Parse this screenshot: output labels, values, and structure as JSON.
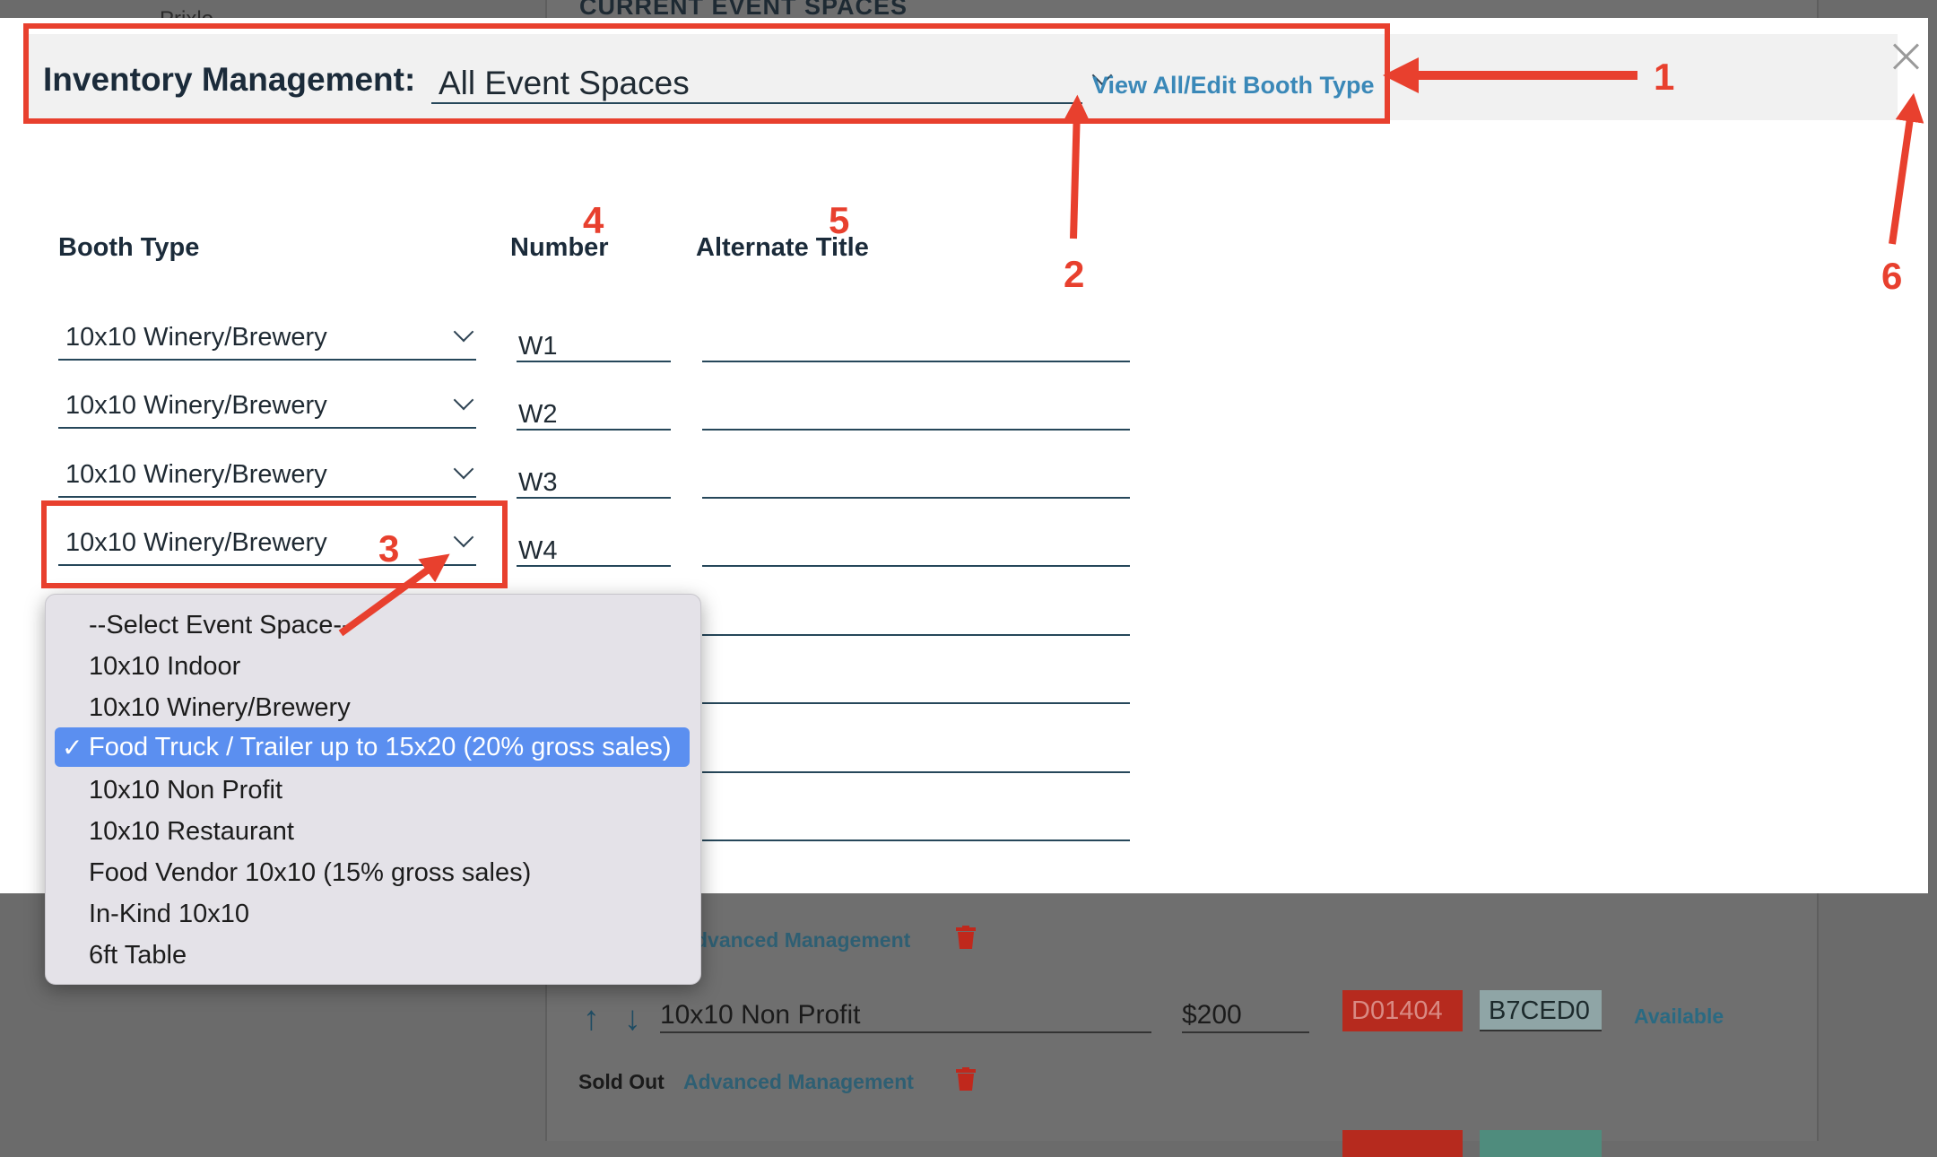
{
  "background": {
    "left_text": "Prixlo...",
    "heading": "CURRENT EVENT SPACES",
    "row1": {
      "advanced_link": "dvanced Management"
    },
    "row2": {
      "booth_type": "10x10 Non Profit",
      "price": "$200",
      "color1": "D01404",
      "color2": "B7CED0",
      "status": "Available",
      "sold_out_label": "Sold Out",
      "advanced_link": "Advanced Management"
    },
    "colors": {
      "red_swatch": "#b62a1e",
      "teal_swatch": "#8fa5a6"
    }
  },
  "modal": {
    "title": "Inventory Management:",
    "event_space_select": "All Event Spaces",
    "view_all_link": "View All/Edit Booth Type",
    "columns": {
      "booth_type": "Booth Type",
      "number": "Number",
      "alternate_title": "Alternate Title"
    },
    "rows": [
      {
        "booth_type": "10x10 Winery/Brewery",
        "number": "W1",
        "alternate_title": ""
      },
      {
        "booth_type": "10x10 Winery/Brewery",
        "number": "W2",
        "alternate_title": ""
      },
      {
        "booth_type": "10x10 Winery/Brewery",
        "number": "W3",
        "alternate_title": ""
      },
      {
        "booth_type": "10x10 Winery/Brewery",
        "number": "W4",
        "alternate_title": ""
      }
    ]
  },
  "dropdown": {
    "options": [
      "--Select Event Space--",
      "10x10 Indoor",
      "10x10 Winery/Brewery",
      "Food Truck / Trailer up to 15x20 (20% gross sales)",
      "10x10 Non Profit",
      "10x10 Restaurant",
      "Food Vendor 10x10 (15% gross sales)",
      "In-Kind 10x10",
      "6ft Table"
    ],
    "selected": "Food Truck / Trailer up to 15x20 (20% gross sales)",
    "check": "✓"
  },
  "annotations": {
    "n1": "1",
    "n2": "2",
    "n3": "3",
    "n4": "4",
    "n5": "5",
    "n6": "6",
    "color": "#e8402e"
  }
}
